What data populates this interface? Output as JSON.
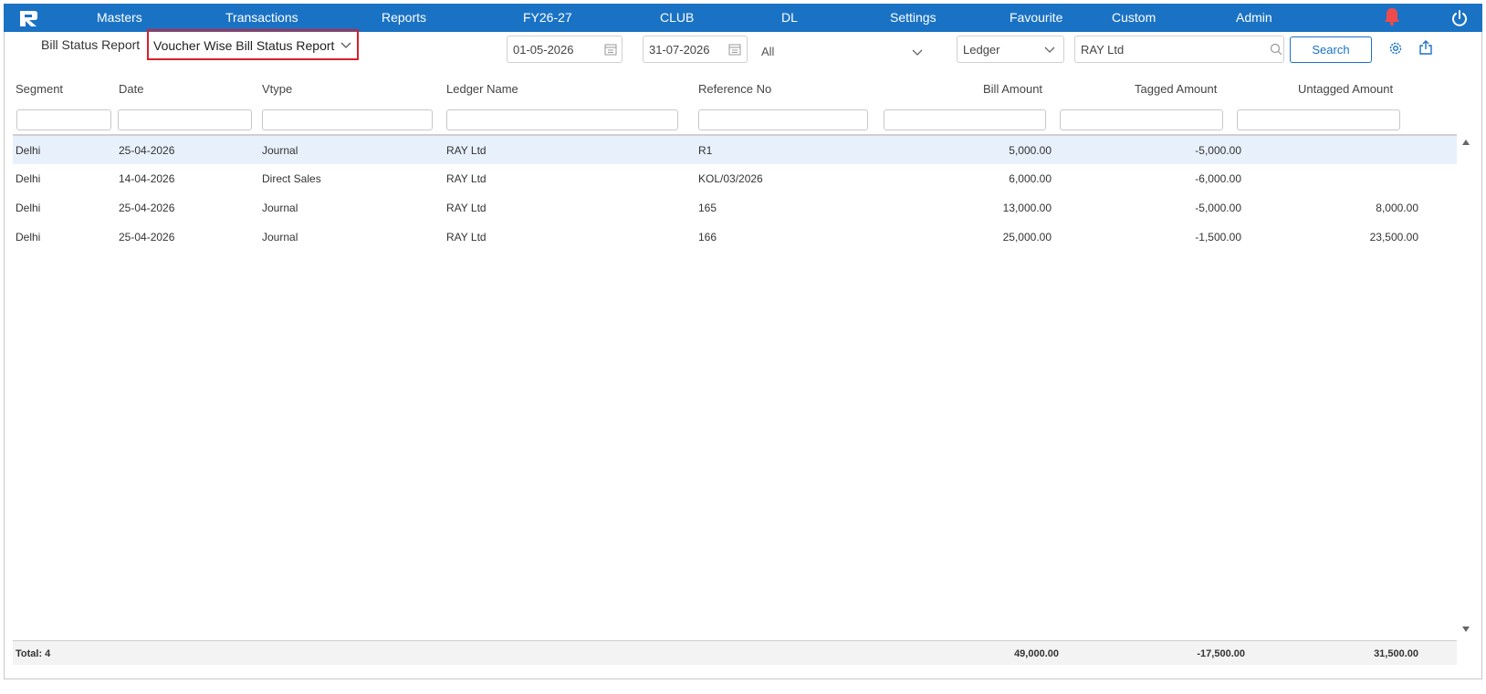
{
  "nav": {
    "items": [
      "Masters",
      "Transactions",
      "Reports",
      "FY26-27",
      "CLUB",
      "DL",
      "Settings",
      "Favourite",
      "Custom",
      "Admin"
    ],
    "logo_icon": "app-logo-icon",
    "bell_icon": "bell-icon",
    "power_icon": "power-icon",
    "accent": "#1a72c4",
    "bell_color": "#f04b4b"
  },
  "toolbar": {
    "breadcrumb": "Bill Status Report",
    "report_type": "Voucher Wise Bill Status Report",
    "from_date": "01-05-2026",
    "to_date": "31-07-2026",
    "segment_filter": "All",
    "search_by": "Ledger",
    "search_value": "RAY Ltd",
    "search_label": "Search"
  },
  "table": {
    "columns": [
      "Segment",
      "Date",
      "Vtype",
      "Ledger Name",
      "Reference No",
      "Bill Amount",
      "Tagged Amount",
      "Untagged Amount"
    ],
    "rows": [
      {
        "segment": "Delhi",
        "date": "25-04-2026",
        "vtype": "Journal",
        "ledger": "RAY Ltd",
        "ref": "R1",
        "bill": "5,000.00",
        "tagged": "-5,000.00",
        "untagged": ""
      },
      {
        "segment": "Delhi",
        "date": "14-04-2026",
        "vtype": "Direct Sales",
        "ledger": "RAY Ltd",
        "ref": "KOL/03/2026",
        "bill": "6,000.00",
        "tagged": "-6,000.00",
        "untagged": ""
      },
      {
        "segment": "Delhi",
        "date": "25-04-2026",
        "vtype": "Journal",
        "ledger": "RAY Ltd",
        "ref": "165",
        "bill": "13,000.00",
        "tagged": "-5,000.00",
        "untagged": "8,000.00"
      },
      {
        "segment": "Delhi",
        "date": "25-04-2026",
        "vtype": "Journal",
        "ledger": "RAY Ltd",
        "ref": "166",
        "bill": "25,000.00",
        "tagged": "-1,500.00",
        "untagged": "23,500.00"
      }
    ],
    "selected_row": 0
  },
  "footer": {
    "total_label": "Total: 4",
    "bill_total": "49,000.00",
    "tagged_total": "-17,500.00",
    "untagged_total": "31,500.00"
  }
}
